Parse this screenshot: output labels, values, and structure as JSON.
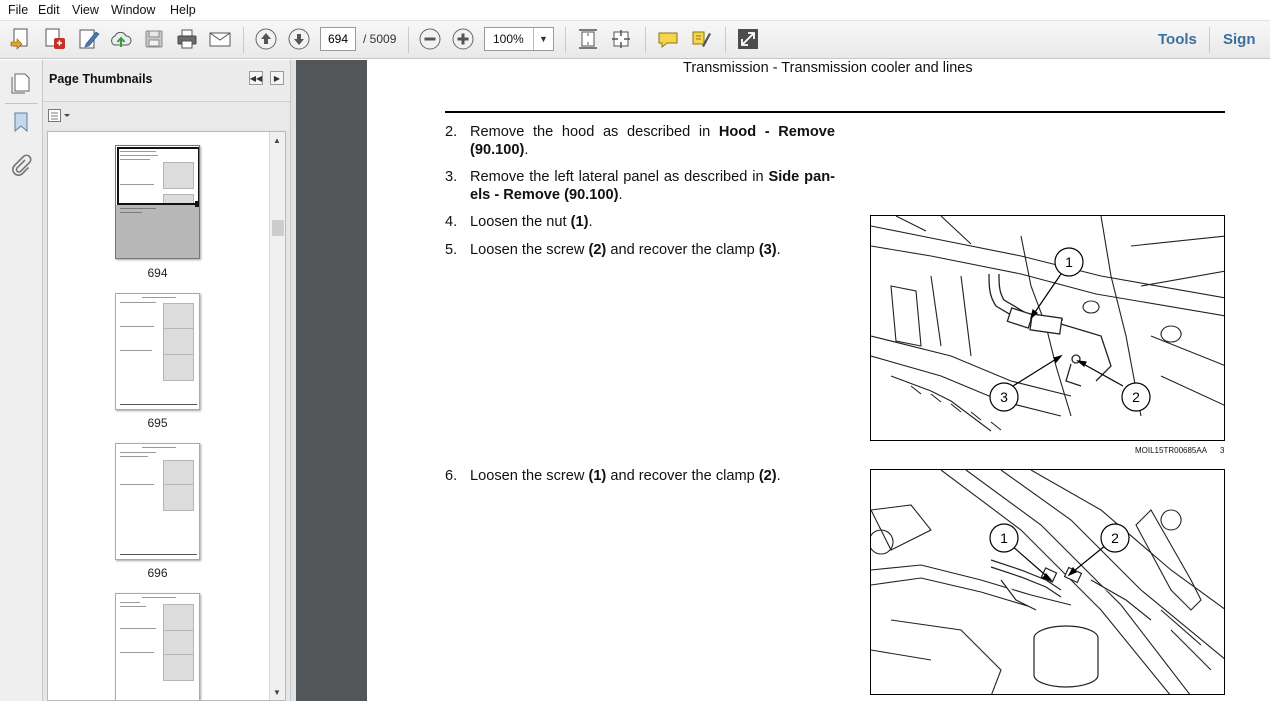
{
  "menu": [
    "File",
    "Edit",
    "View",
    "Window",
    "Help"
  ],
  "toolbar": {
    "page_current": "694",
    "page_total": "/ 5009",
    "zoom": "100%",
    "tools_label": "Tools",
    "sign_label": "Sign"
  },
  "panel": {
    "title": "Page Thumbnails",
    "thumbnails": [
      "694",
      "695",
      "696"
    ]
  },
  "document": {
    "running_header": "Transmission - Transmission cooler and lines",
    "steps": [
      {
        "num": "2.",
        "parts": [
          "Remove the hood as described in ",
          "Hood - Remove (90.100)",
          "."
        ]
      },
      {
        "num": "3.",
        "parts": [
          "Remove the left lateral panel as described in ",
          "Side pan­els - Remove (90.100)",
          "."
        ]
      },
      {
        "num": "4.",
        "parts": [
          "Loosen the nut ",
          "(1)",
          "."
        ]
      },
      {
        "num": "5.",
        "parts": [
          "Loosen the screw ",
          "(2)",
          " and recover the clamp ",
          "(3)",
          "."
        ]
      },
      {
        "num": "6.",
        "parts": [
          "Loosen the screw ",
          "(1)",
          " and recover the clamp ",
          "(2)",
          "."
        ]
      }
    ],
    "figure1": {
      "callouts": [
        "1",
        "2",
        "3"
      ],
      "code": "MOIL15TR00685AA",
      "number": "3"
    },
    "figure2": {
      "callouts": [
        "1",
        "2"
      ]
    }
  }
}
